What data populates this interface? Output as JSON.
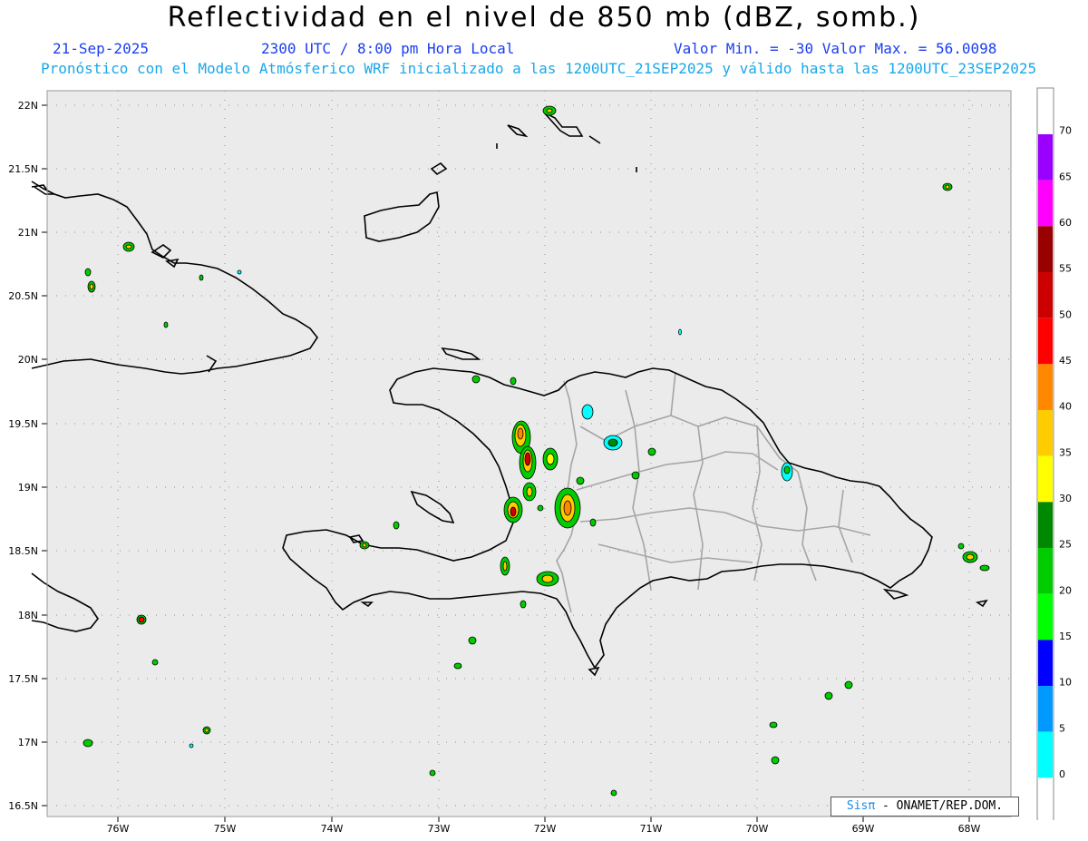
{
  "header": {
    "title": "Reflectividad en el nivel de 850 mb (dBZ, somb.)",
    "date": "21-Sep-2025",
    "time": "2300 UTC / 8:00 pm Hora Local",
    "minmax": "Valor Min. = -30  Valor Max. = 56.0098",
    "forecast": "Pronóstico con el Modelo Atmósferico WRF inicializado a las 1200UTC_21SEP2025 y válido hasta las  1200UTC_23SEP2025"
  },
  "axes": {
    "lat_labels": [
      "22N",
      "21.5N",
      "21N",
      "20.5N",
      "20N",
      "19.5N",
      "19N",
      "18.5N",
      "18N",
      "17.5N",
      "17N",
      "16.5N"
    ],
    "lon_labels": [
      "76W",
      "75W",
      "74W",
      "73W",
      "72W",
      "71W",
      "70W",
      "69W",
      "68W"
    ]
  },
  "colorbar": {
    "labels": [
      "0",
      "5",
      "10",
      "15",
      "20",
      "25",
      "30",
      "35",
      "40",
      "45",
      "50",
      "55",
      "60",
      "65",
      "70"
    ],
    "colors": [
      "#ffffff",
      "#00ffff",
      "#0099ff",
      "#0000ff",
      "#00ff00",
      "#00cc00",
      "#008800",
      "#ffff00",
      "#ffcc00",
      "#ff8800",
      "#ff0000",
      "#cc0000",
      "#990000",
      "#ff00ff",
      "#9900ff"
    ],
    "background": "#ebebeb"
  },
  "credit": {
    "brand": "Sisπ",
    "text": "- ONAMET/REP.DOM."
  }
}
